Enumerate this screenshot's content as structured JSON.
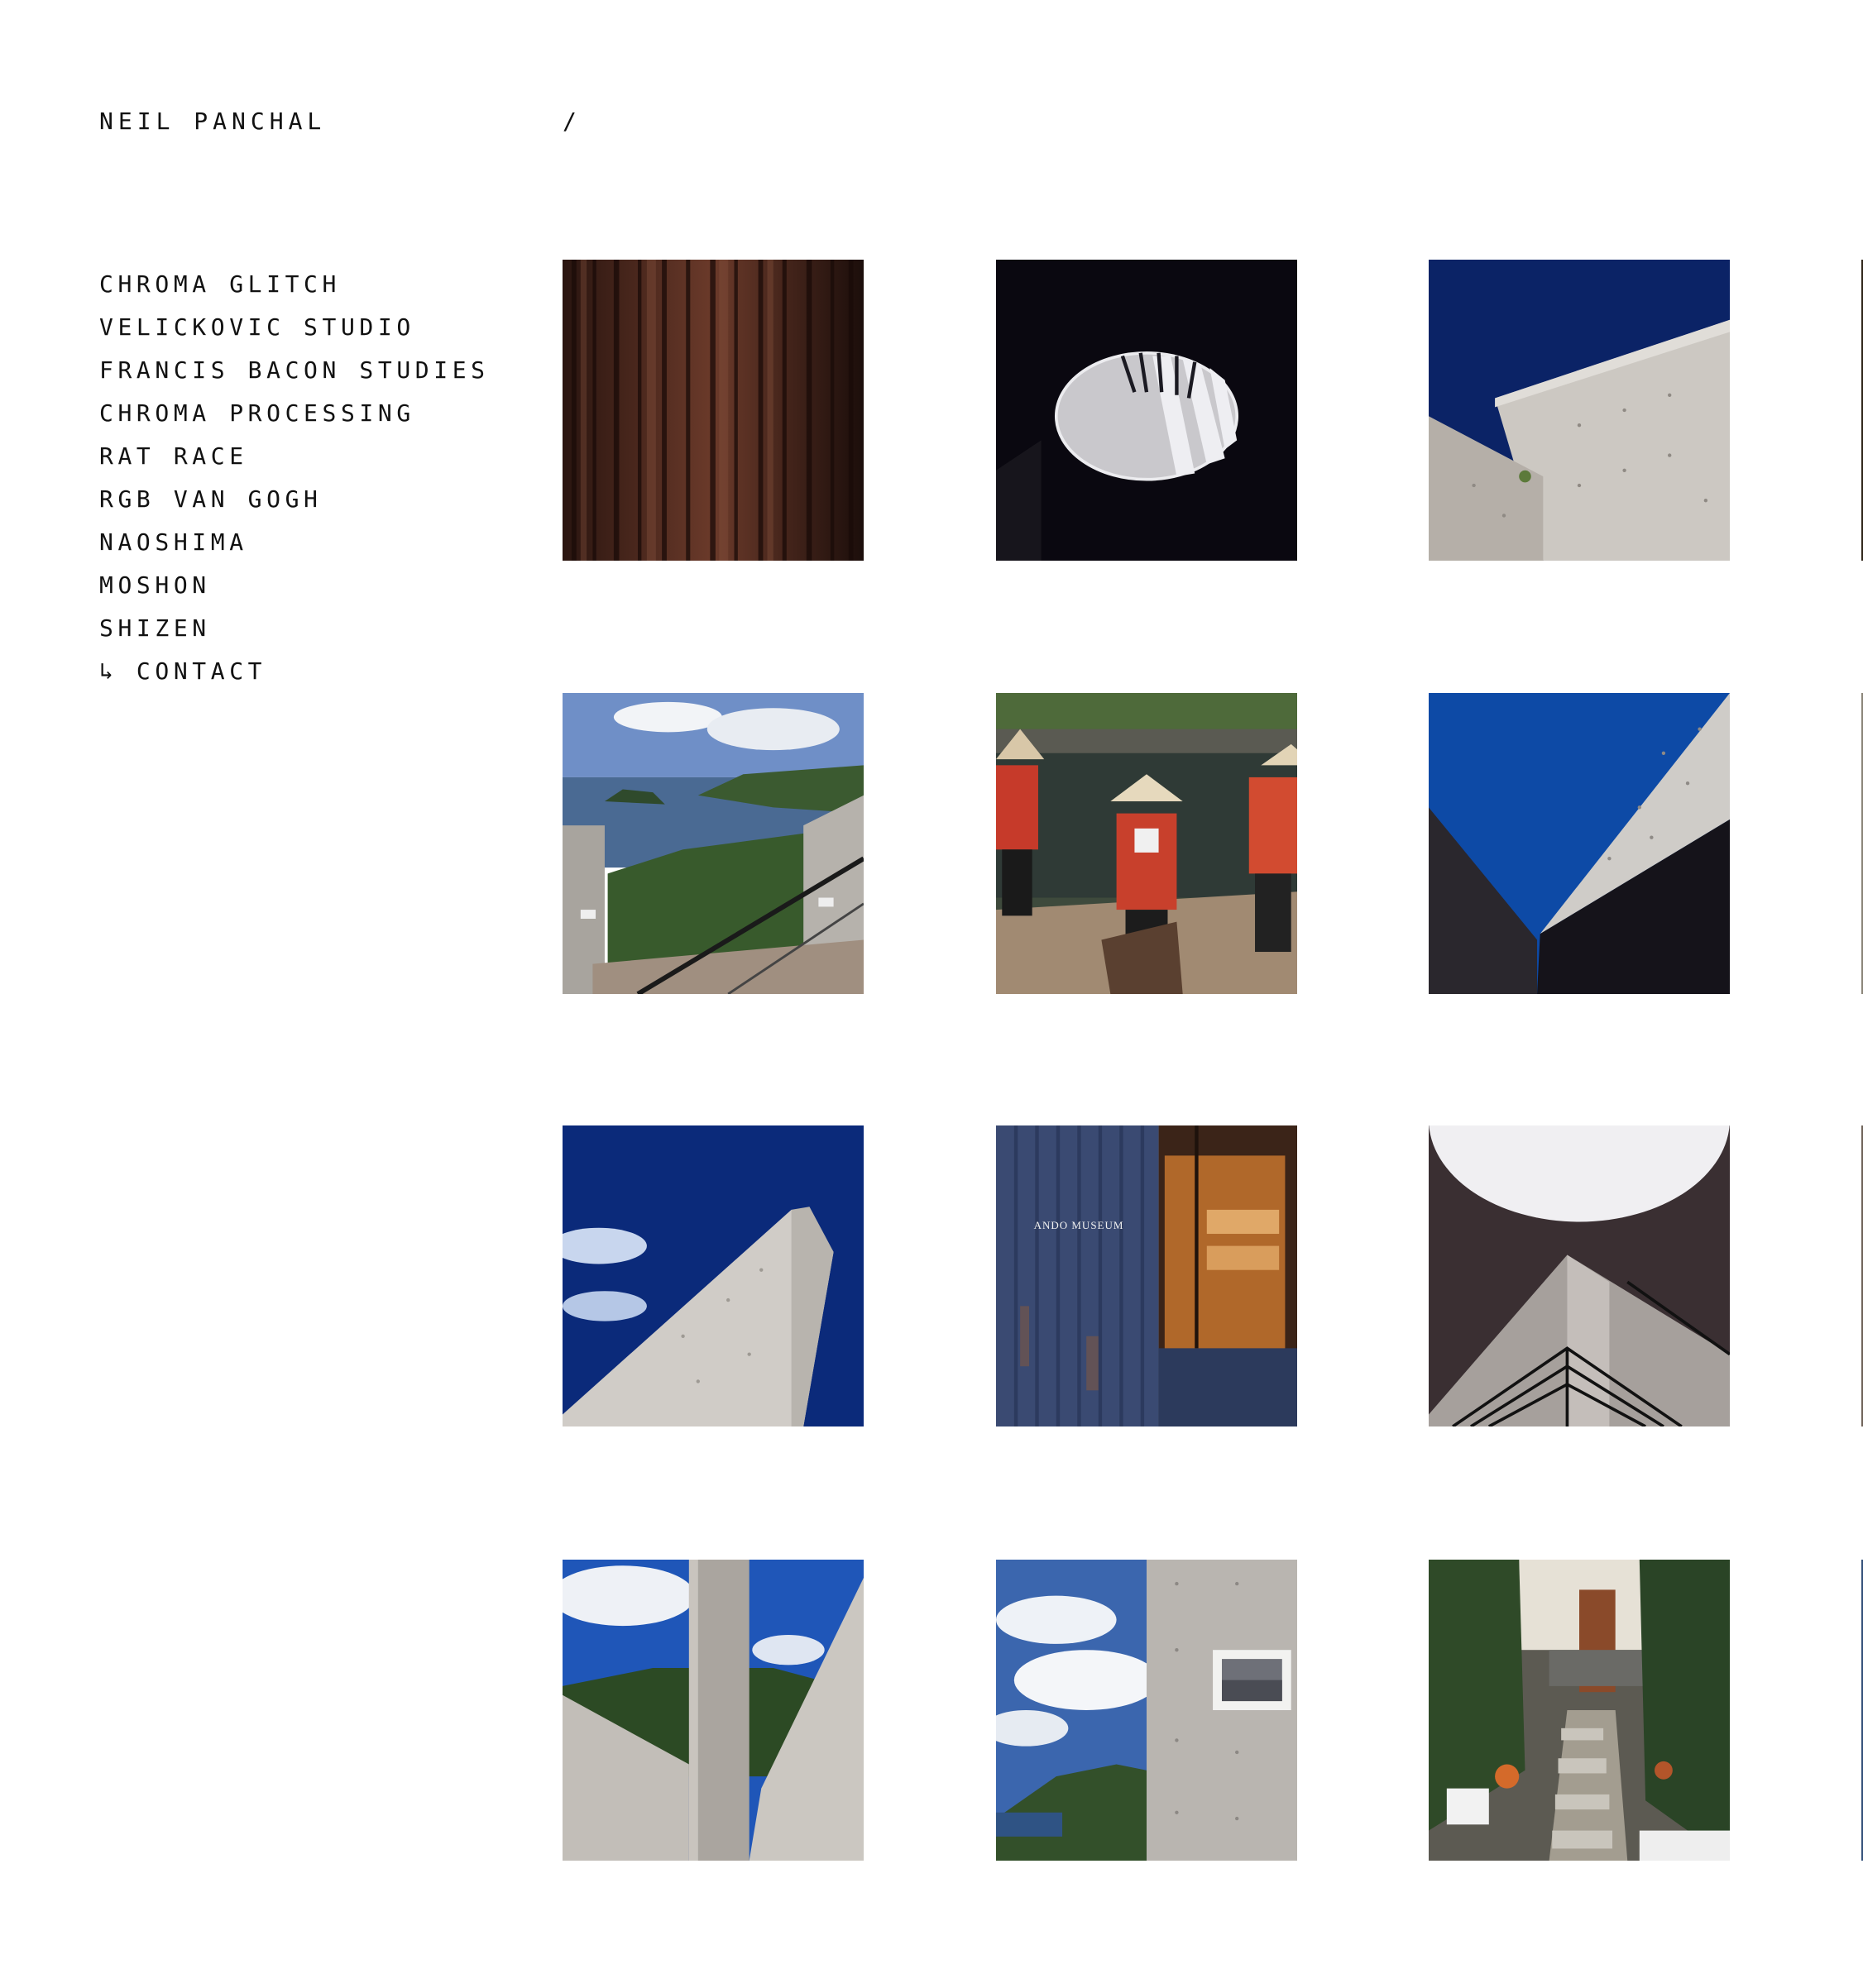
{
  "header": {
    "site_name": "NEIL PANCHAL",
    "breadcrumb": "/"
  },
  "nav": {
    "items": [
      {
        "label": "CHROMA GLITCH"
      },
      {
        "label": "VELICKOVIC STUDIO"
      },
      {
        "label": "FRANCIS BACON STUDIES"
      },
      {
        "label": "CHROMA PROCESSING"
      },
      {
        "label": "RAT RACE"
      },
      {
        "label": "RGB VAN GOGH"
      },
      {
        "label": "NAOSHIMA"
      },
      {
        "label": "MOSHON"
      },
      {
        "label": "SHIZEN"
      },
      {
        "label": "↳ CONTACT"
      }
    ]
  },
  "gallery": {
    "photos": [
      {
        "subject": "dark wood slats"
      },
      {
        "subject": "oval skylight"
      },
      {
        "subject": "concrete wall against blue sky"
      },
      {
        "subject": "island view from terrace"
      },
      {
        "subject": "festival figures in red coats"
      },
      {
        "subject": "concrete wedge and blue sky"
      },
      {
        "subject": "concrete pillar against blue sky"
      },
      {
        "subject": "museum entrance door",
        "sign_text": "ANDO MUSEUM"
      },
      {
        "subject": "circular skylight over stairs"
      },
      {
        "subject": "concrete column between walls"
      },
      {
        "subject": "concrete wall with framed photo"
      },
      {
        "subject": "alley with potted plants"
      }
    ]
  }
}
